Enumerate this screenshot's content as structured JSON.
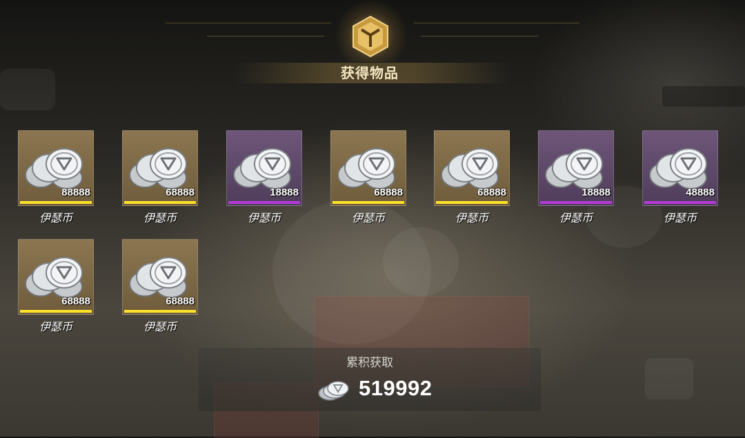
{
  "header": {
    "title": "获得物品",
    "emblem_icon": "hexagon-y-emblem-icon"
  },
  "items": [
    {
      "name": "伊瑟币",
      "count": "88888",
      "rarity": "gold"
    },
    {
      "name": "伊瑟币",
      "count": "68888",
      "rarity": "gold"
    },
    {
      "name": "伊瑟币",
      "count": "18888",
      "rarity": "purple"
    },
    {
      "name": "伊瑟币",
      "count": "68888",
      "rarity": "gold"
    },
    {
      "name": "伊瑟币",
      "count": "68888",
      "rarity": "gold"
    },
    {
      "name": "伊瑟币",
      "count": "18888",
      "rarity": "purple"
    },
    {
      "name": "伊瑟币",
      "count": "48888",
      "rarity": "purple"
    },
    {
      "name": "伊瑟币",
      "count": "68888",
      "rarity": "gold"
    },
    {
      "name": "伊瑟币",
      "count": "68888",
      "rarity": "gold"
    }
  ],
  "summary": {
    "label": "累积获取",
    "total": "519992",
    "icon": "coin-stack-icon"
  },
  "colors": {
    "gold_tile": "#8b7650",
    "purple_tile": "#6e5679",
    "gold_bar": "#ffe32b",
    "purple_bar": "#b53ad8",
    "title_text": "#f4e6c2"
  }
}
